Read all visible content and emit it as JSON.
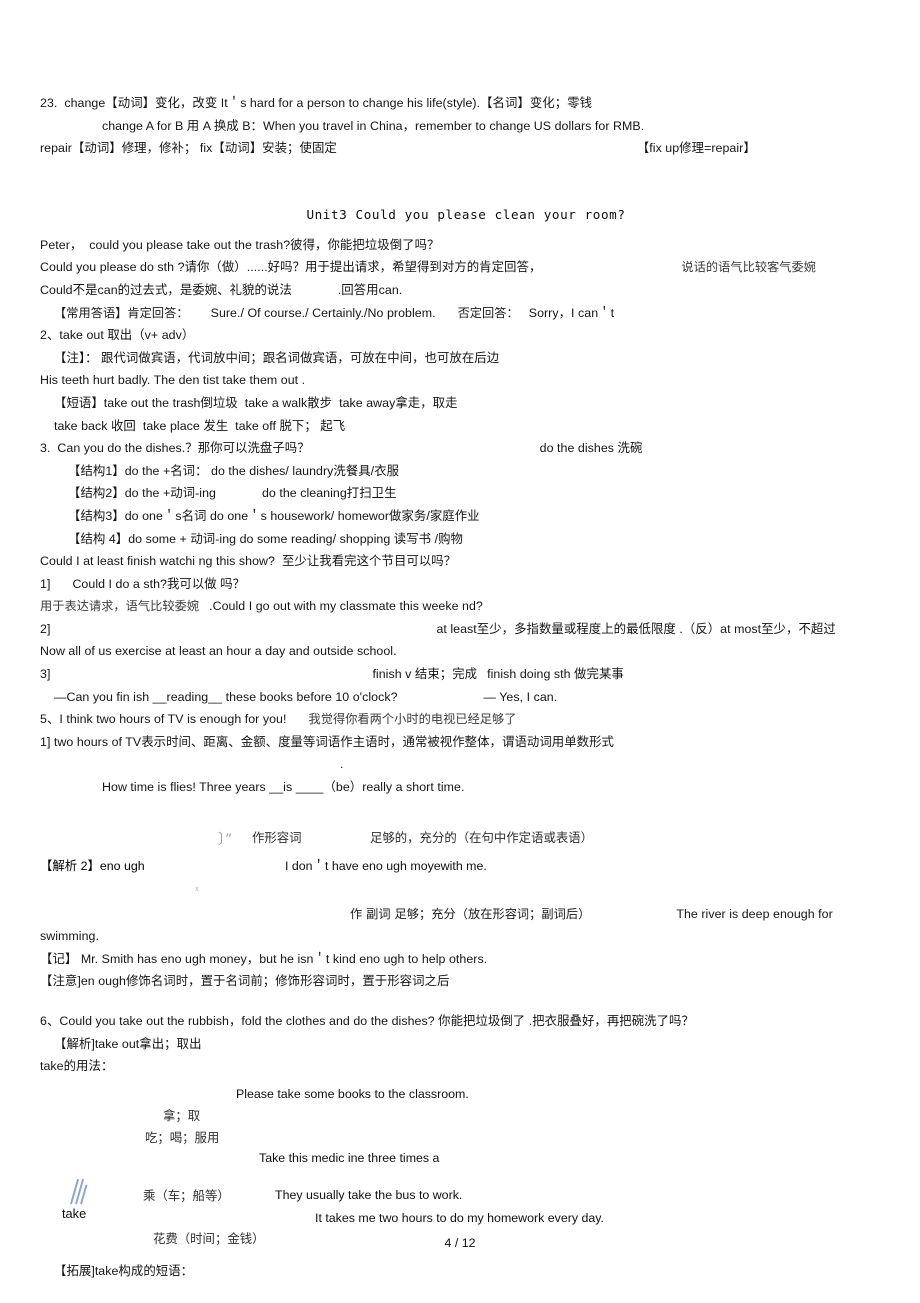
{
  "document": {
    "page_label": "4 / 12",
    "unit_title": "Unit3 Could you please clean your room?"
  },
  "section_23": {
    "line1": "23.  change【动词】变化，改变 It＇s hard for a person to change his life(style).【名词】变化；零钱",
    "line2": "change A for B 用 A 换成 B：When you travel in China，remember to change US dollars for RMB.",
    "line3_a": "repair【动词】修理，修补； fix【动词】安装；使固定",
    "line3_b": "【fix up修理=repair】"
  },
  "unit3": {
    "l_peter": "Peter，  could you please take out the trash?彼得，你能把垃圾倒了吗？",
    "l_could_sth_a": "Could you please do sth ?请你（做）......好吗？用于提出请求，希望得到对方的肯定回答，",
    "l_could_sth_b": "说话的语气比较客气委婉",
    "l_could_not_a": "Could不是can的过去式，是委婉、礼貌的说法",
    "l_could_not_b": ".回答用can.",
    "l_answers_a": "【常用答语】肯定回答：",
    "l_answers_b": "Sure./ Of course./ Certainly./No problem.",
    "l_answers_c": "否定回答：",
    "l_answers_d": "Sorry，I can＇t",
    "l_takeout_head": "2、take out 取出（v+ adv）",
    "l_note": "【注】： 跟代词做宾语，代词放中间；跟名词做宾语，可放在中间，也可放在后边",
    "l_teeth": "His teeth hurt badly. The den tist take them out .",
    "l_phrases1": "【短语】take out the trash倒垃圾  take a walk散步  take away拿走，取走",
    "l_phrases2": "take back 收回  take place 发生  take off 脱下； 起飞",
    "l_dishes_a": "3.  Can you do the dishes.？那你可以洗盘子吗？",
    "l_dishes_b": "do the dishes 洗碗",
    "l_struct1": "【结构1】do the +名词： do the dishes/ laundry洗餐具/衣服",
    "l_struct2_a": "【结构2】do the +动词-ing",
    "l_struct2_b": "do the cleaning打扫卫生",
    "l_struct3": "【结构3】do one＇s名词 do one＇s housework/ homewor做家务/家庭作业",
    "l_struct4": "【结构 4】do some + 动词-ing do some reading/ shopping 读写书 /购物",
    "l_atleast_q": "Could I at least finish watchi ng this show?  至少让我看完这个节目可以吗？",
    "l_item1_num": "1]",
    "l_item1_text": "Could I do a sth?我可以做 吗？",
    "l_item1_note_a": "用于表达请求，语气比较委婉",
    "l_item1_note_b": ".Could I go out with my classmate this weeke nd?",
    "l_item2_num": "2]",
    "l_item2_text": "at least至少，多指数量或程度上的最低限度 .（反）at most至少，不超过",
    "l_exercise": "Now all of us exercise at least an hour a day and outside school.",
    "l_item3_num": "3]",
    "l_item3_a": "finish v 结束；完成",
    "l_item3_b": "finish doing sth 做完某事",
    "l_finish_q_a": "—Can you fin ish __reading__ these books before 10 o'clock?",
    "l_finish_q_b": "— Yes, I can.",
    "l_point5_a": "5、I think two hours of TV is enough for you!",
    "l_point5_b": "我觉得你看两个小时的电视已经足够了",
    "l_p5_1_a": "1] two hours of TV表示时间、距离、金额、度量等词语作主语时，通常被视作整体，谓语动词用单数形式",
    "l_p5_1_b": ".",
    "l_howtime": "How time is flies! Three years __is ____（be）really a short time.",
    "l_enough_adj_role": "作形容词",
    "l_enough_adj_mean": "足够的，充分的（在句中作定语或表语）",
    "l_enough_head": "【解析 2】eno ugh",
    "l_enough_ex1": "I don＇t have eno ugh moyewith me.",
    "l_enough_adv": "作 副词 足够；充分（放在形容词；副词后）",
    "l_enough_ex2": "The river is deep enough for swimming.",
    "l_remember": "【记】 Mr. Smith has eno ugh money，but he isn＇t kind eno ugh to help others.",
    "l_attention": "【注意]en ough修饰名词时，置于名词前；修饰形容词时，置于形容词之后",
    "l_point6": "6、Could you take out the rubbish，fold the clothes and do the dishes? 你能把垃圾倒了 .把衣服叠好，再把碗洗了吗？",
    "l_p6_analysis": "【解析]take out拿出；取出",
    "l_take_usage": "take的用法："
  },
  "take_diagram": {
    "center_word": "take",
    "entries": [
      {
        "label": "拿；取",
        "example": "Please take some books to the classroom."
      },
      {
        "label": "吃；喝；服用",
        "example": "Take this medic ine three times a"
      },
      {
        "label": "乘（车；船等）",
        "example": "They usually take the bus to work."
      },
      {
        "label": "花费（时间；金钱）",
        "example": "It takes me two hours to do my homework every day."
      }
    ]
  },
  "expansion": {
    "l_expand": "【拓展]take构成的短语："
  },
  "colors": {
    "text": "#101010",
    "chinese_gray": "#3a3a3a",
    "blue_mark": "#8ea8d0",
    "faint_blue": "#9fb4d6"
  }
}
